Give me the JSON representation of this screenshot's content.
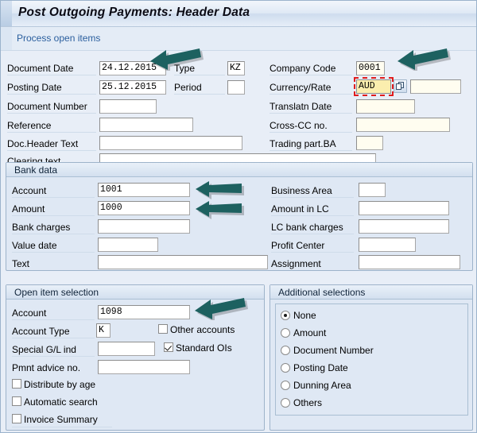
{
  "window": {
    "title": "Post Outgoing Payments: Header Data",
    "subheader_link": "Process open items"
  },
  "header_section": {
    "left_fields": [
      {
        "label": "Document Date",
        "value": "24.12.2015"
      },
      {
        "label": "Posting Date",
        "value": "25.12.2015"
      },
      {
        "label": "Document Number",
        "value": ""
      },
      {
        "label": "Reference",
        "value": ""
      },
      {
        "label": "Doc.Header Text",
        "value": ""
      },
      {
        "label": "Clearing text",
        "value": ""
      }
    ],
    "mid_fields": [
      {
        "label": "Type",
        "value": "KZ"
      },
      {
        "label": "Period",
        "value": ""
      }
    ],
    "right_fields": [
      {
        "label": "Company Code",
        "value": "0001"
      },
      {
        "label": "Currency/Rate",
        "value": "AUD",
        "rate_value": ""
      },
      {
        "label": "Translatn Date",
        "value": ""
      },
      {
        "label": "Cross-CC no.",
        "value": ""
      },
      {
        "label": "Trading part.BA",
        "value": ""
      }
    ]
  },
  "bank_data": {
    "title": "Bank data",
    "left_fields": [
      {
        "label": "Account",
        "value": "1001"
      },
      {
        "label": "Amount",
        "value": "1000"
      },
      {
        "label": "Bank charges",
        "value": ""
      },
      {
        "label": "Value date",
        "value": ""
      },
      {
        "label": "Text",
        "value": ""
      }
    ],
    "right_fields": [
      {
        "label": "Business Area",
        "value": ""
      },
      {
        "label": "Amount in LC",
        "value": ""
      },
      {
        "label": "LC bank charges",
        "value": ""
      },
      {
        "label": "Profit Center",
        "value": ""
      },
      {
        "label": "Assignment",
        "value": ""
      }
    ]
  },
  "open_item_selection": {
    "title": "Open item selection",
    "fields": [
      {
        "label": "Account",
        "value": "1098"
      },
      {
        "label": "Account Type",
        "value": "K"
      },
      {
        "label": "Special G/L ind",
        "value": ""
      },
      {
        "label": "Pmnt advice no.",
        "value": ""
      }
    ],
    "inline_checkboxes": [
      {
        "label": "Other accounts",
        "checked": false
      },
      {
        "label": "Standard OIs",
        "checked": true
      }
    ],
    "checkboxes": [
      {
        "label": "Distribute by age",
        "checked": false
      },
      {
        "label": "Automatic search",
        "checked": false
      },
      {
        "label": "Invoice Summary",
        "checked": false
      }
    ]
  },
  "additional_selections": {
    "title": "Additional selections",
    "options": [
      {
        "label": "None",
        "selected": true
      },
      {
        "label": "Amount",
        "selected": false
      },
      {
        "label": "Document Number",
        "selected": false
      },
      {
        "label": "Posting Date",
        "selected": false
      },
      {
        "label": "Dunning Area",
        "selected": false
      },
      {
        "label": "Others",
        "selected": false
      }
    ]
  },
  "annotations": {
    "arrow_color": "#1d6160",
    "arrows": [
      {
        "target": "document-date-field"
      },
      {
        "target": "company-code-field"
      },
      {
        "target": "bank-account-field"
      },
      {
        "target": "bank-amount-field"
      },
      {
        "target": "open-item-account-field"
      }
    ]
  },
  "icons": {
    "matchcode": "matchcode-icon"
  }
}
